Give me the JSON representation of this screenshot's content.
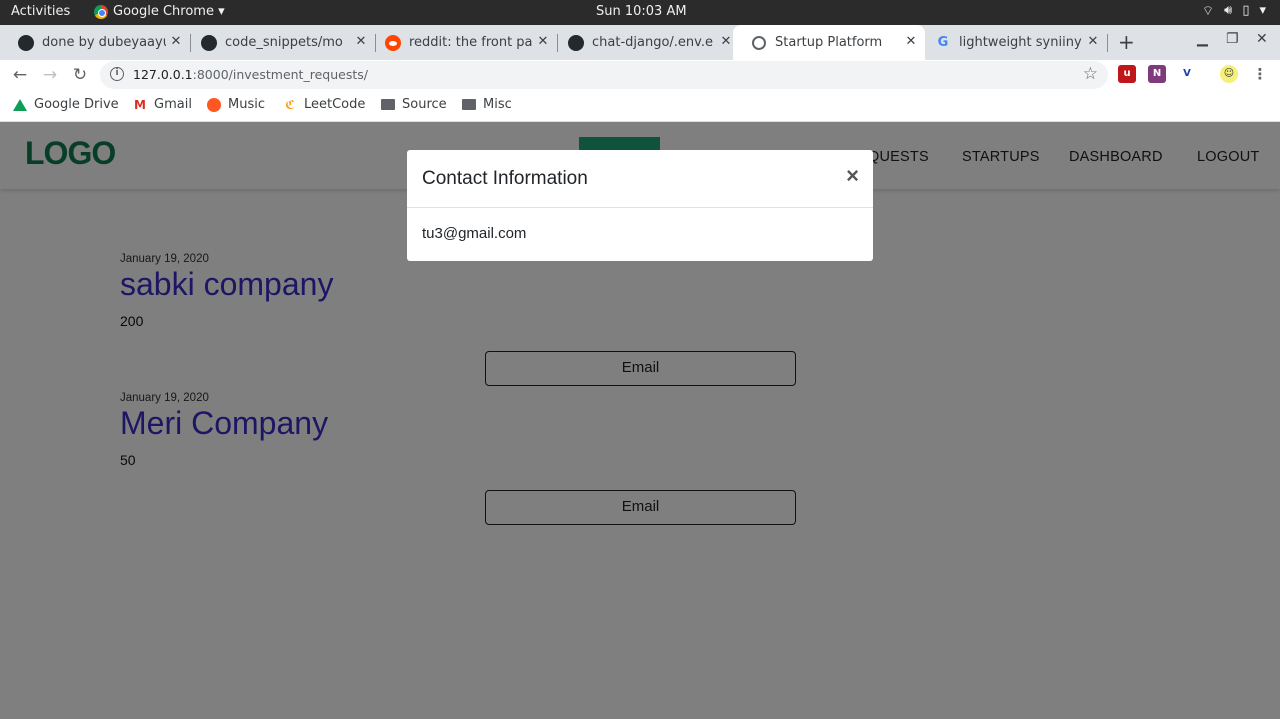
{
  "os": {
    "activities": "Activities",
    "app_menu": "Google Chrome ▾",
    "clock": "Sun 10:03 AM"
  },
  "tabs": [
    {
      "title": "done by dubeyaayu",
      "icon": "github-icon"
    },
    {
      "title": "code_snippets/mo",
      "icon": "github-icon"
    },
    {
      "title": "reddit: the front pa",
      "icon": "reddit-icon"
    },
    {
      "title": "chat-django/.env.e",
      "icon": "github-icon"
    },
    {
      "title": "Startup Platform",
      "icon": "globe-icon",
      "active": true
    },
    {
      "title": "lightweight syniiny",
      "icon": "google-icon"
    }
  ],
  "address": {
    "host": "127.0.0.1",
    "path": ":8000/investment_requests/"
  },
  "bookmarks": [
    "Google Drive",
    "Gmail",
    "Music",
    "LeetCode",
    "Source",
    "Misc"
  ],
  "site": {
    "logo": "LOGO",
    "nav": [
      "QUESTS",
      "STARTUPS",
      "DASHBOARD",
      "LOGOUT"
    ]
  },
  "requests": [
    {
      "date": "January 19, 2020",
      "company": "sabki company",
      "amount": "200",
      "button": "Email"
    },
    {
      "date": "January 19, 2020",
      "company": "Meri Company",
      "amount": "50",
      "button": "Email"
    }
  ],
  "modal": {
    "title": "Contact Information",
    "close": "×",
    "email": "tu3@gmail.com"
  },
  "colors": {
    "logo": "#107c50",
    "nav_active": "#1fa67a",
    "company_name": "#3a2cc8",
    "backdrop": "rgba(0,0,0,0.5)"
  }
}
